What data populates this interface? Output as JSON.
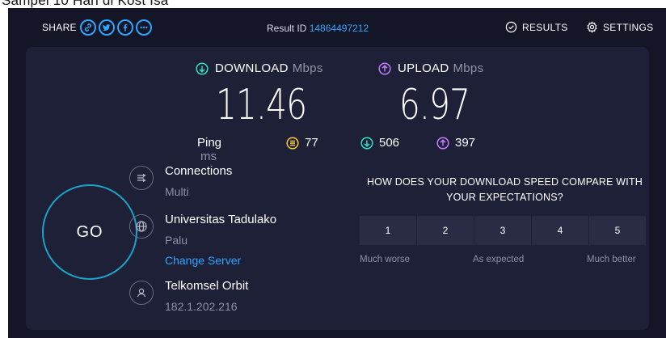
{
  "caption": "Sampel 10 Hari di Kost Isa",
  "share": {
    "label": "SHARE",
    "icons": [
      "link-icon",
      "twitter-icon",
      "facebook-icon",
      "more-icon"
    ]
  },
  "result": {
    "label": "Result ID",
    "id": "14864497212"
  },
  "nav": {
    "results": "RESULTS",
    "settings": "SETTINGS"
  },
  "download": {
    "label": "DOWNLOAD",
    "unit": "Mbps",
    "value": "11.46",
    "color": "#2ee0c8"
  },
  "upload": {
    "label": "UPLOAD",
    "unit": "Mbps",
    "value": "6.97",
    "color": "#c07cff"
  },
  "ping": {
    "label": "Ping",
    "unit": "ms",
    "idle": "77",
    "download": "506",
    "upload": "397",
    "idle_color": "#f7c93b"
  },
  "go_label": "GO",
  "connections": {
    "title": "Connections",
    "value": "Multi"
  },
  "server": {
    "name": "Universitas Tadulako",
    "location": "Palu",
    "change_link": "Change Server"
  },
  "provider": {
    "name": "Telkomsel Orbit",
    "ip": "182.1.202.216"
  },
  "survey": {
    "question": "HOW DOES YOUR DOWNLOAD SPEED COMPARE WITH YOUR EXPECTATIONS?",
    "options": [
      "1",
      "2",
      "3",
      "4",
      "5"
    ],
    "labels": {
      "low": "Much worse",
      "mid": "As expected",
      "high": "Much better"
    }
  },
  "colors": {
    "background": "#141526",
    "panel": "#1e2037",
    "accent": "#2ea7ff",
    "go_ring": "#1aa3c9"
  }
}
